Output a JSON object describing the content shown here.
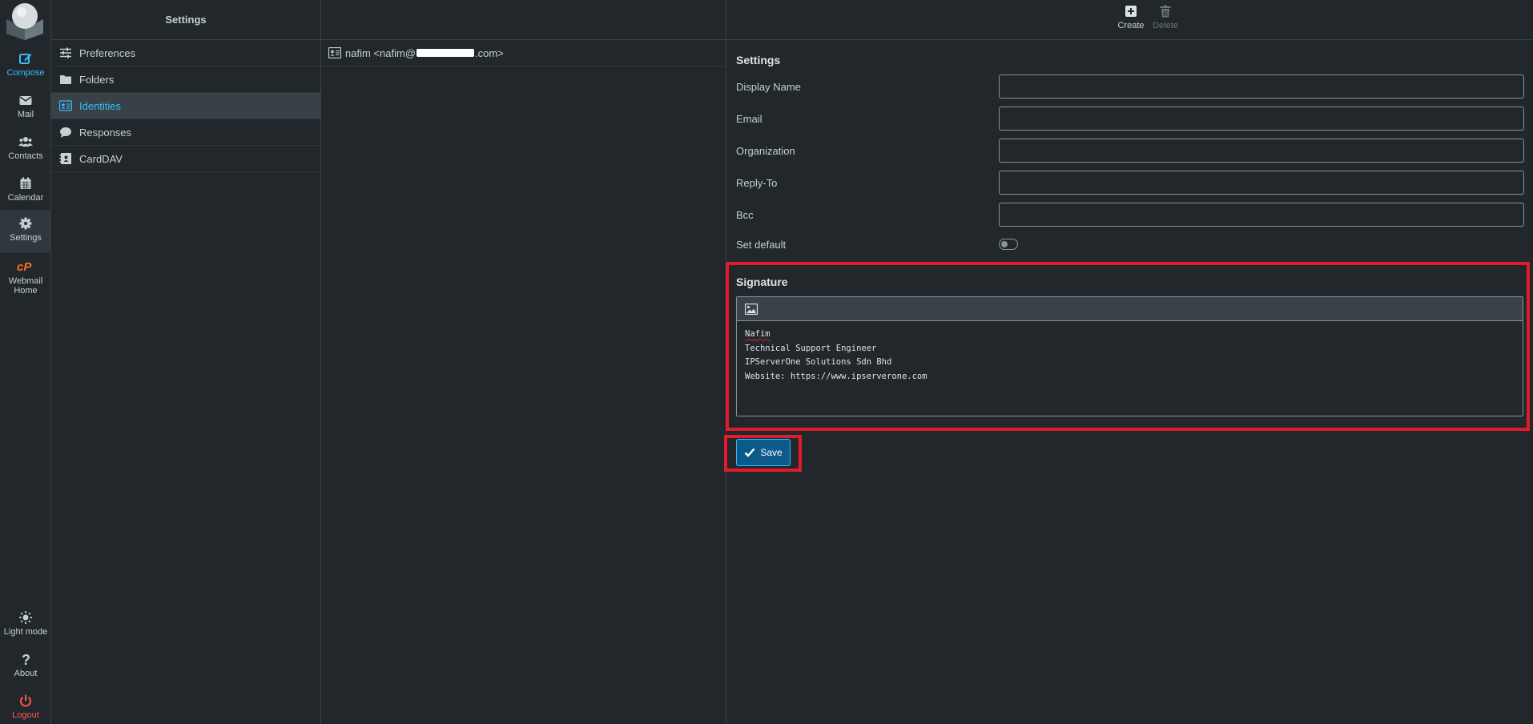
{
  "rail": {
    "items": [
      {
        "label": "Compose",
        "icon": "compose-icon"
      },
      {
        "label": "Mail",
        "icon": "mail-icon"
      },
      {
        "label": "Contacts",
        "icon": "contacts-icon"
      },
      {
        "label": "Calendar",
        "icon": "calendar-icon"
      },
      {
        "label": "Settings",
        "icon": "gear-icon"
      },
      {
        "label_line1": "Webmail",
        "label_line2": "Home",
        "icon": "cpanel-icon"
      }
    ],
    "bottom": [
      {
        "label": "Light mode",
        "icon": "sun-icon"
      },
      {
        "label": "About",
        "icon": "question-icon"
      },
      {
        "label": "Logout",
        "icon": "power-icon"
      }
    ]
  },
  "nav": {
    "title": "Settings",
    "items": [
      {
        "label": "Preferences",
        "icon": "sliders-icon"
      },
      {
        "label": "Folders",
        "icon": "folder-icon"
      },
      {
        "label": "Identities",
        "icon": "id-card-icon"
      },
      {
        "label": "Responses",
        "icon": "comment-icon"
      },
      {
        "label": "CardDAV",
        "icon": "address-book-icon"
      }
    ],
    "active": "Identities"
  },
  "identities": {
    "rows": [
      {
        "prefix": "nafim <nafim@",
        "suffix": ".com>",
        "icon": "id-card-icon"
      }
    ]
  },
  "toolbar": {
    "create_label": "Create",
    "delete_label": "Delete"
  },
  "form": {
    "section_title": "Settings",
    "fields": [
      {
        "label": "Display Name",
        "value": ""
      },
      {
        "label": "Email",
        "value": ""
      },
      {
        "label": "Organization",
        "value": ""
      },
      {
        "label": "Reply-To",
        "value": ""
      },
      {
        "label": "Bcc",
        "value": ""
      }
    ],
    "set_default_label": "Set default",
    "set_default": false
  },
  "signature": {
    "title": "Signature",
    "lines": [
      "Nafim",
      "Technical Support Engineer",
      "IPServerOne Solutions Sdn Bhd",
      "Website: https://www.ipserverone.com"
    ]
  },
  "save_label": "Save",
  "colors": {
    "background": "#21272b",
    "accent": "#37beff",
    "highlight_box": "#e01b2a",
    "logout": "#ff5552",
    "save_button": "#0b5a8a"
  }
}
